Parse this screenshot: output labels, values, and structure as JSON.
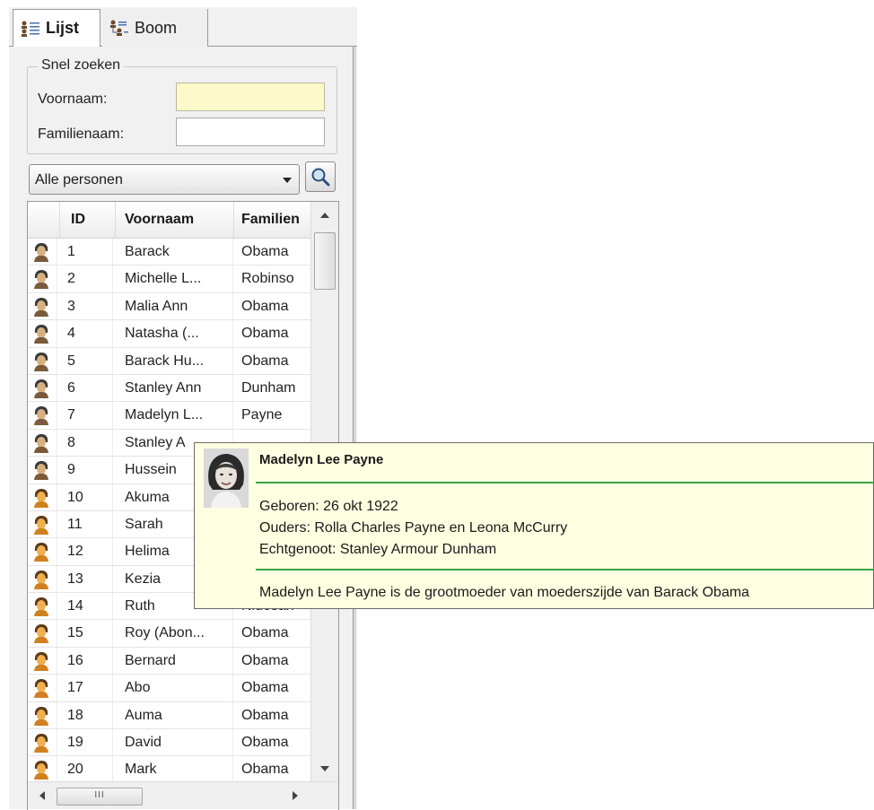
{
  "tabs": [
    {
      "label": "Lijst",
      "icon": "list-icon",
      "active": true
    },
    {
      "label": "Boom",
      "icon": "tree-icon",
      "active": false
    }
  ],
  "quick_search": {
    "legend": "Snel zoeken",
    "first_name_label": "Voornaam:",
    "first_name_value": "",
    "last_name_label": "Familienaam:",
    "last_name_value": ""
  },
  "filter": {
    "selected": "Alle personen",
    "search_icon": "magnifier-icon"
  },
  "table": {
    "columns": [
      "",
      "ID",
      "Voornaam",
      "Familien"
    ],
    "rows": [
      {
        "id": "1",
        "first": "Barack",
        "last": "Obama",
        "icon": "person-gray-icon"
      },
      {
        "id": "2",
        "first": "Michelle L...",
        "last": "Robinso",
        "icon": "person-gray-icon"
      },
      {
        "id": "3",
        "first": "Malia Ann",
        "last": "Obama",
        "icon": "person-gray-icon"
      },
      {
        "id": "4",
        "first": "Natasha (...",
        "last": "Obama",
        "icon": "person-gray-icon"
      },
      {
        "id": "5",
        "first": "Barack Hu...",
        "last": "Obama",
        "icon": "person-gray-icon"
      },
      {
        "id": "6",
        "first": "Stanley Ann",
        "last": "Dunham",
        "icon": "person-gray-icon"
      },
      {
        "id": "7",
        "first": "Madelyn L...",
        "last": "Payne",
        "icon": "person-gray-icon"
      },
      {
        "id": "8",
        "first": "Stanley A",
        "last": "",
        "icon": "person-gray-icon"
      },
      {
        "id": "9",
        "first": "Hussein",
        "last": "",
        "icon": "person-gray-icon"
      },
      {
        "id": "10",
        "first": "Akuma",
        "last": "",
        "icon": "person-orange-icon"
      },
      {
        "id": "11",
        "first": "Sarah",
        "last": "",
        "icon": "person-orange-icon"
      },
      {
        "id": "12",
        "first": "Helima",
        "last": "",
        "icon": "person-orange-icon"
      },
      {
        "id": "13",
        "first": "Kezia",
        "last": "",
        "icon": "person-orange-icon"
      },
      {
        "id": "14",
        "first": "Ruth",
        "last": "Nidesan",
        "icon": "person-orange-icon"
      },
      {
        "id": "15",
        "first": "Roy (Abon...",
        "last": "Obama",
        "icon": "person-orange-icon"
      },
      {
        "id": "16",
        "first": "Bernard",
        "last": "Obama",
        "icon": "person-orange-icon"
      },
      {
        "id": "17",
        "first": "Abo",
        "last": "Obama",
        "icon": "person-orange-icon"
      },
      {
        "id": "18",
        "first": "Auma",
        "last": "Obama",
        "icon": "person-orange-icon"
      },
      {
        "id": "19",
        "first": "David",
        "last": "Obama",
        "icon": "person-orange-icon"
      },
      {
        "id": "20",
        "first": "Mark",
        "last": "Obama",
        "icon": "person-orange-icon"
      }
    ]
  },
  "tooltip": {
    "name": "Madelyn Lee Payne",
    "born": "Geboren: 26 okt 1922",
    "parents": "Ouders: Rolla Charles Payne en Leona McCurry",
    "spouse": "Echtgenoot: Stanley Armour Dunham",
    "description": "Madelyn Lee Payne is de grootmoeder van moederszijde van Barack Obama",
    "photo_icon": "portrait-photo"
  },
  "colors": {
    "tooltip_bg": "#ffffe1",
    "separator": "#3aa24a",
    "highlight_input": "#fbfac8"
  }
}
